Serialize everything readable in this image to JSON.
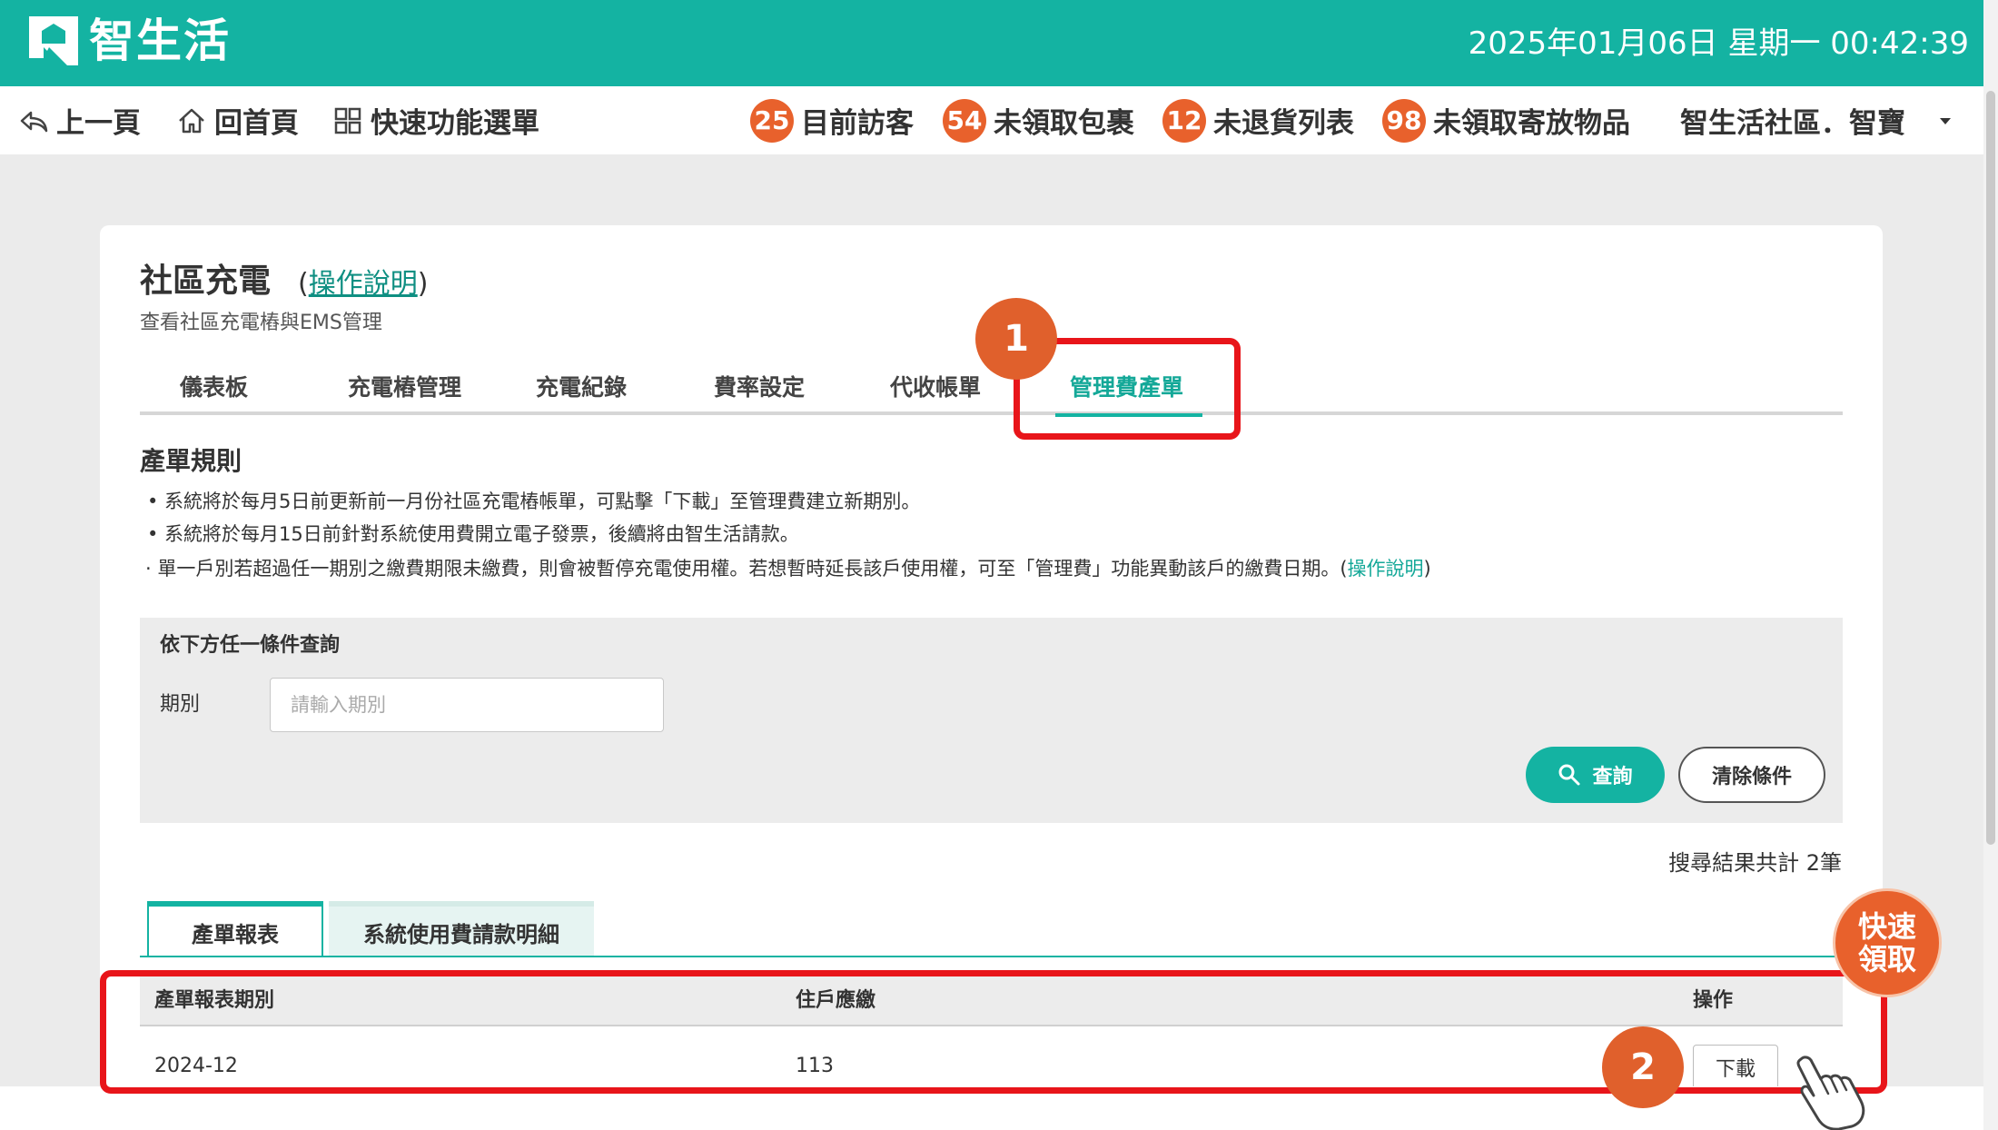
{
  "header": {
    "brand": "智生活",
    "datetime": "2025年01月06日 星期一 00:42:39"
  },
  "nav": {
    "back": "上一頁",
    "home": "回首頁",
    "quick_menu": "快速功能選單",
    "counters": [
      {
        "count": "25",
        "label": "目前訪客"
      },
      {
        "count": "54",
        "label": "未領取包裹"
      },
      {
        "count": "12",
        "label": "未退貨列表"
      },
      {
        "count": "98",
        "label": "未領取寄放物品"
      }
    ],
    "community": "智生活社區．智寶"
  },
  "page": {
    "title": "社區充電",
    "help_open": "(",
    "help_link": "操作說明",
    "help_close": ")",
    "subtitle": "查看社區充電樁與EMS管理"
  },
  "tabs": [
    "儀表板",
    "充電樁管理",
    "充電紀錄",
    "費率設定",
    "代收帳單",
    "管理費產單"
  ],
  "active_tab": "管理費產單",
  "rules": {
    "title": "產單規則",
    "items": [
      "•  系統將於每月5日前更新前一月份社區充電樁帳單，可點擊「下載」至管理費建立新期別。",
      "•  系統將於每月15日前針對系統使用費開立電子發票，後續將由智生活請款。",
      "· 單一戶別若超過任一期別之繳費期限未繳費，則會被暫停充電使用權。若想暫時延長該戶使用權，可至「管理費」功能異動該戶的繳費日期。("
    ],
    "item3_link": "操作說明",
    "item3_close": ")"
  },
  "query": {
    "title": "依下方任一條件查詢",
    "period_label": "期別",
    "period_placeholder": "請輸入期別",
    "period_value": "",
    "search_button": "查詢",
    "clear_button": "清除條件"
  },
  "result_count": "搜尋結果共計 2筆",
  "subtabs": [
    "產單報表",
    "系統使用費請款明細"
  ],
  "table": {
    "headers": [
      "產單報表期別",
      "住戶應繳",
      "操作"
    ],
    "rows": [
      {
        "period": "2024-12",
        "amount": "113",
        "action": "下載"
      }
    ]
  },
  "annotations": {
    "step1": "1",
    "step2": "2"
  },
  "quick_pickup": "快速領取",
  "colors": {
    "brand": "#14b3a2",
    "badge": "#e8612c",
    "highlight": "#e8151a"
  }
}
